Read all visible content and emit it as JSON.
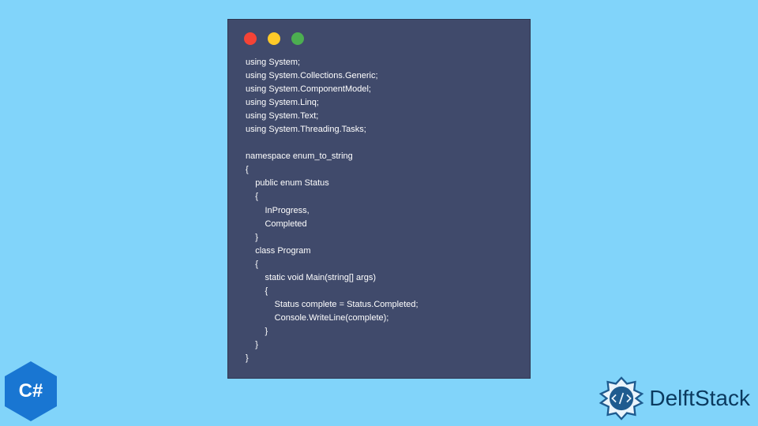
{
  "window": {
    "traffic_lights": [
      "red",
      "yellow",
      "green"
    ]
  },
  "code": {
    "lines": [
      "using System;",
      "using System.Collections.Generic;",
      "using System.ComponentModel;",
      "using System.Linq;",
      "using System.Text;",
      "using System.Threading.Tasks;",
      "",
      "namespace enum_to_string",
      "{",
      "    public enum Status",
      "    {",
      "        InProgress,",
      "        Completed",
      "    }",
      "    class Program",
      "    {",
      "        static void Main(string[] args)",
      "        {",
      "            Status complete = Status.Completed;",
      "            Console.WriteLine(complete);",
      "        }",
      "    }",
      "}"
    ]
  },
  "badges": {
    "csharp_label": "C#",
    "delft_label": "DelftStack"
  },
  "colors": {
    "background": "#81d4fa",
    "window_bg": "#404a6b",
    "code_text": "#ffffff",
    "hex_fill": "#1976d2",
    "delft_text": "#0b3a5f",
    "delft_icon": "#1e5b8f"
  }
}
